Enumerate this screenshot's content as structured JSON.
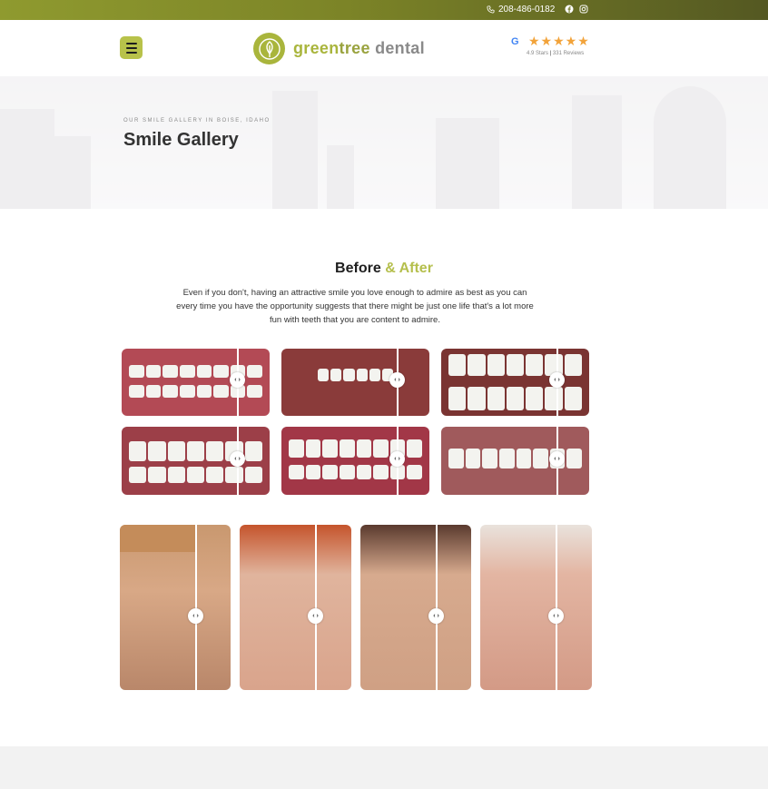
{
  "topbar": {
    "phone": "208-486-0182",
    "social": [
      "facebook-icon",
      "instagram-icon"
    ],
    "colors": {
      "start": "#8f9a2f",
      "end": "#545822"
    }
  },
  "header": {
    "logo": {
      "word1": "green",
      "word2": "tree",
      "word3": " dental"
    },
    "rating": {
      "stars": "★★★★★",
      "score": "4.9 Stars",
      "reviews": "331 Reviews",
      "google": "G"
    }
  },
  "hero": {
    "eyebrow": "OUR SMILE GALLERY IN BOISE, IDAHO",
    "title": "Smile Gallery"
  },
  "intro": {
    "heading": "Before",
    "heading_accent": "& After",
    "text": "Even if you don't, having an attractive smile you love enough to admire as best as you can every time you have the opportunity suggests that there might be just one life that's a lot more fun with teeth that you are content to admire."
  },
  "gallery": {
    "handle_glyph": "‹ ›",
    "smiles": [
      {
        "label": "smile-comparison-1"
      },
      {
        "label": "smile-comparison-2"
      },
      {
        "label": "smile-comparison-3"
      },
      {
        "label": "smile-comparison-4"
      },
      {
        "label": "smile-comparison-5"
      },
      {
        "label": "smile-comparison-6"
      }
    ],
    "portraits": [
      {
        "label": "portrait-comparison-1"
      },
      {
        "label": "portrait-comparison-2"
      },
      {
        "label": "portrait-comparison-3"
      },
      {
        "label": "portrait-comparison-4"
      }
    ]
  },
  "theme": {
    "accent": "#a9b53c",
    "star": "#f2a33a"
  }
}
